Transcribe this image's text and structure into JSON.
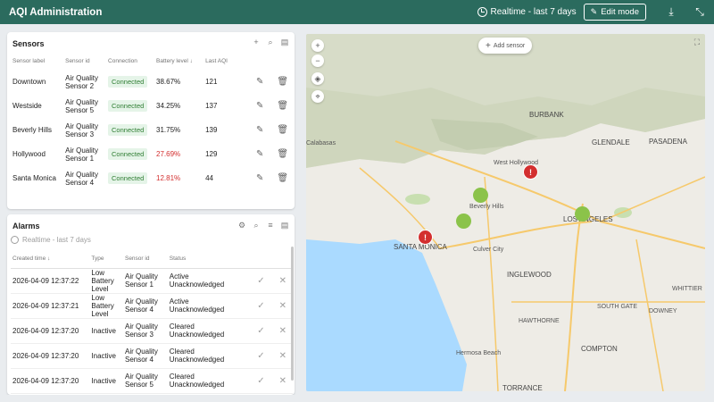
{
  "header": {
    "title": "AQI Administration",
    "timewindow": "Realtime - last 7 days",
    "edit_label": "Edit mode"
  },
  "sensors": {
    "title": "Sensors",
    "columns": [
      "Sensor label",
      "Sensor id",
      "Connection",
      "Battery level",
      "Last AQI"
    ],
    "rows": [
      {
        "label": "Downtown",
        "id1": "Air Quality",
        "id2": "Sensor 2",
        "connection": "Connected",
        "battery": "38.67%",
        "aqi": "121"
      },
      {
        "label": "Westside",
        "id1": "Air Quality",
        "id2": "Sensor 5",
        "connection": "Connected",
        "battery": "34.25%",
        "aqi": "137"
      },
      {
        "label": "Beverly Hills",
        "id1": "Air Quality",
        "id2": "Sensor 3",
        "connection": "Connected",
        "battery": "31.75%",
        "aqi": "139"
      },
      {
        "label": "Hollywood",
        "id1": "Air Quality",
        "id2": "Sensor 1",
        "connection": "Connected",
        "battery": "27.69%",
        "aqi": "129"
      },
      {
        "label": "Santa Monica",
        "id1": "Air Quality",
        "id2": "Sensor 4",
        "connection": "Connected",
        "battery": "12.81%",
        "aqi": "44"
      }
    ]
  },
  "alarms": {
    "title": "Alarms",
    "subtitle": "Realtime - last 7 days",
    "columns": [
      "Created time",
      "Type",
      "Sensor id",
      "Status"
    ],
    "rows": [
      {
        "time": "2026-04-09 12:37:22",
        "type1": "Low",
        "type2": "Battery",
        "type3": "Level",
        "s1": "Air Quality",
        "s2": "Sensor 1",
        "st1": "Active",
        "st2": "Unacknowledged"
      },
      {
        "time": "2026-04-09 12:37:21",
        "type1": "Low",
        "type2": "Battery",
        "type3": "Level",
        "s1": "Air Quality",
        "s2": "Sensor 4",
        "st1": "Active",
        "st2": "Unacknowledged"
      },
      {
        "time": "2026-04-09 12:37:20",
        "type1": "Inactive",
        "type2": "",
        "type3": "",
        "s1": "Air Quality",
        "s2": "Sensor 3",
        "st1": "Cleared",
        "st2": "Unacknowledged"
      },
      {
        "time": "2026-04-09 12:37:20",
        "type1": "Inactive",
        "type2": "",
        "type3": "",
        "s1": "Air Quality",
        "s2": "Sensor 4",
        "st1": "Cleared",
        "st2": "Unacknowledged"
      },
      {
        "time": "2026-04-09 12:37:20",
        "type1": "Inactive",
        "type2": "",
        "type3": "",
        "s1": "Air Quality",
        "s2": "Sensor 5",
        "st1": "Cleared",
        "st2": "Unacknowledged"
      }
    ]
  },
  "map": {
    "add_sensor": "Add sensor",
    "labels": {
      "burbank": "BURBANK",
      "glendale": "GLENDALE",
      "pasadena": "PASADENA",
      "west_hollywood": "West Hollywood",
      "beverly_hills": "Beverly Hills",
      "los_angeles": "LOS ANGELES",
      "santa_monica": "SANTA MONICA",
      "culver_city": "Culver City",
      "inglewood": "INGLEWOOD",
      "south_gate": "SOUTH GATE",
      "downey": "DOWNEY",
      "hawthorne": "HAWTHORNE",
      "compton": "COMPTON",
      "torrance": "TORRANCE",
      "hermosa_beach": "Hermosa Beach",
      "calabasas": "Calabasas",
      "whittier": "WHITTIER"
    }
  },
  "colors": {
    "header": "#2b6b5e",
    "connected_bg": "#e5f4e8",
    "connected_text": "#2e7d32",
    "low_battery": "#d32f2f",
    "sensor_ok": "#8bc34a",
    "sensor_alarm": "#d32f2f"
  }
}
